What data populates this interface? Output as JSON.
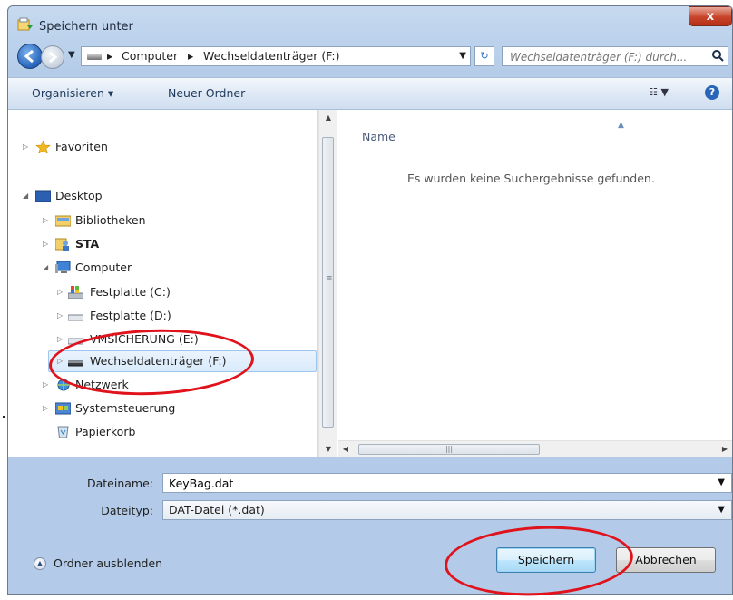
{
  "window": {
    "title": "Speichern unter",
    "close_label": "x"
  },
  "address_bar": {
    "segments": [
      "Computer",
      "Wechseldatenträger (F:)"
    ]
  },
  "search": {
    "placeholder": "Wechseldatenträger (F:) durch..."
  },
  "toolbar": {
    "organize_label": "Organisieren ▾",
    "new_folder_label": "Neuer Ordner"
  },
  "tree": {
    "items": [
      {
        "label": "Favoriten",
        "icon": "star-icon"
      },
      {
        "label": "Desktop",
        "icon": "desktop-icon"
      },
      {
        "label": "Bibliotheken",
        "icon": "libraries-icon"
      },
      {
        "label": "STA",
        "icon": "user-folder-icon"
      },
      {
        "label": "Computer",
        "icon": "computer-icon"
      },
      {
        "label": "Festplatte (C:)",
        "icon": "system-drive-icon"
      },
      {
        "label": "Festplatte (D:)",
        "icon": "drive-icon"
      },
      {
        "label": "VMSICHERUNG (E:)",
        "icon": "drive-icon"
      },
      {
        "label": "Wechseldatenträger (F:)",
        "icon": "removable-drive-icon"
      },
      {
        "label": "Netzwerk",
        "icon": "network-icon"
      },
      {
        "label": "Systemsteuerung",
        "icon": "control-panel-icon"
      },
      {
        "label": "Papierkorb",
        "icon": "recycle-bin-icon"
      }
    ],
    "selected": "Wechseldatenträger (F:)"
  },
  "file_list": {
    "column_name": "Name",
    "empty_message": "Es wurden keine Suchergebnisse gefunden."
  },
  "form": {
    "filename_label": "Dateiname:",
    "filename_value": "KeyBag.dat",
    "filetype_label": "Dateityp:",
    "filetype_value": "DAT-Datei (*.dat)"
  },
  "footer": {
    "hide_folders_label": "Ordner ausblenden",
    "save_label": "Speichern",
    "cancel_label": "Abbrechen"
  },
  "colors": {
    "annotation": "#e0121b",
    "accent": "#2764b9"
  }
}
